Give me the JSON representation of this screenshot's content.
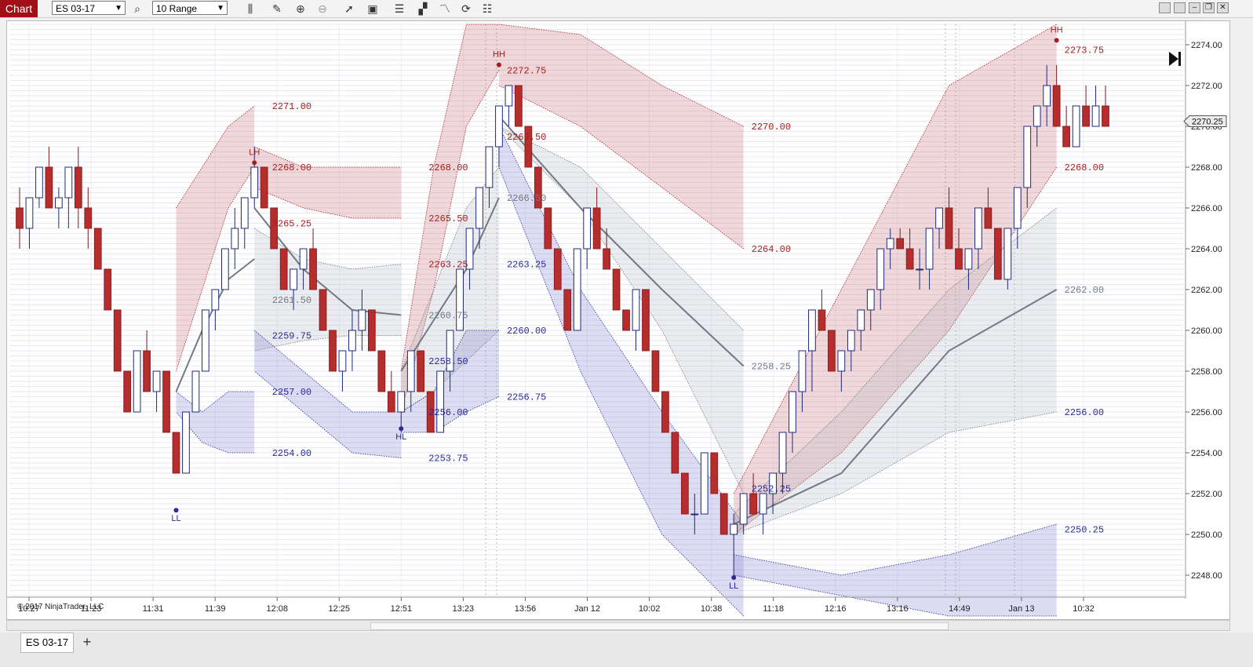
{
  "toolbar": {
    "chart_label": "Chart",
    "instrument": "ES 03-17",
    "bar_type": "10 Range"
  },
  "tabs": [
    {
      "label": "ES 03-17"
    },
    {
      "label": "+"
    }
  ],
  "copyright": "© 2017 NinjaTrader, LLC",
  "colors": {
    "up_bar": "#ffffff",
    "up_outline": "#1c2a7a",
    "down_bar": "#b52d2d",
    "resistance": "#a81e1e",
    "support": "#2a2a9a",
    "mid": "#707a82",
    "accent": "#a10f17"
  },
  "chart_data": {
    "type": "candlestick",
    "y_range": [
      2247,
      2275
    ],
    "y_ticks": [
      "2274.00",
      "2272.00",
      "2270.00",
      "2268.00",
      "2266.00",
      "2264.00",
      "2262.00",
      "2260.00",
      "2258.00",
      "2256.00",
      "2254.00",
      "2252.00",
      "2250.00",
      "2248.00"
    ],
    "last_price": "2270.25",
    "x_labels": [
      "10:27",
      "11:23",
      "11:31",
      "11:39",
      "12:08",
      "12:25",
      "12:51",
      "13:23",
      "13:56",
      "Jan 12",
      "10:02",
      "10:38",
      "11:18",
      "12:16",
      "13:16",
      "14:49",
      "Jan 13",
      "10:32"
    ],
    "bars": [
      [
        2266,
        2267,
        2264,
        2265
      ],
      [
        2265,
        2266,
        2264,
        2266.5
      ],
      [
        2266.5,
        2268,
        2266,
        2268
      ],
      [
        2268,
        2269,
        2266,
        2266
      ],
      [
        2266,
        2267,
        2265,
        2266.5
      ],
      [
        2266.5,
        2268,
        2265,
        2268
      ],
      [
        2268,
        2269,
        2265,
        2266
      ],
      [
        2266,
        2267,
        2264,
        2265
      ],
      [
        2265,
        2265,
        2263,
        2263
      ],
      [
        2263,
        2263,
        2262,
        2261
      ],
      [
        2261,
        2261,
        2258,
        2258
      ],
      [
        2258,
        2258,
        2256,
        2256
      ],
      [
        2256,
        2257,
        2256,
        2259
      ],
      [
        2259,
        2260,
        2259,
        2257
      ],
      [
        2257,
        2258,
        2256,
        2258
      ],
      [
        2258,
        2258,
        2256,
        2255
      ],
      [
        2255,
        2255,
        2254,
        2253
      ],
      [
        2253,
        2256,
        2253,
        2256
      ],
      [
        2256,
        2258,
        2256,
        2258
      ],
      [
        2258,
        2259,
        2258,
        2261
      ],
      [
        2261,
        2262,
        2260,
        2262
      ],
      [
        2262,
        2263,
        2262,
        2264
      ],
      [
        2264,
        2266,
        2263,
        2265
      ],
      [
        2265,
        2266,
        2264,
        2266.5
      ],
      [
        2266.5,
        2269,
        2266,
        2268
      ],
      [
        2268,
        2268,
        2266,
        2266
      ],
      [
        2266,
        2266,
        2264,
        2264
      ],
      [
        2264,
        2264,
        2262,
        2262
      ],
      [
        2262,
        2263,
        2261,
        2263
      ],
      [
        2263,
        2264,
        2262,
        2264
      ],
      [
        2264,
        2265,
        2262,
        2262
      ],
      [
        2262,
        2262,
        2260,
        2260
      ],
      [
        2260,
        2260,
        2258,
        2258
      ],
      [
        2258,
        2259,
        2257,
        2259
      ],
      [
        2259,
        2261,
        2258,
        2260
      ],
      [
        2260,
        2262,
        2259,
        2261
      ],
      [
        2261,
        2261,
        2259,
        2259
      ],
      [
        2259,
        2259,
        2257,
        2257
      ],
      [
        2257,
        2258,
        2256,
        2256
      ],
      [
        2256,
        2256,
        2255,
        2257
      ],
      [
        2257,
        2258,
        2256,
        2259
      ],
      [
        2259,
        2259,
        2257,
        2257
      ],
      [
        2257,
        2257,
        2255,
        2255
      ],
      [
        2255,
        2258,
        2255,
        2258
      ],
      [
        2258,
        2259,
        2257,
        2260
      ],
      [
        2260,
        2263,
        2260,
        2263
      ],
      [
        2263,
        2264,
        2262,
        2265
      ],
      [
        2265,
        2267,
        2264,
        2267
      ],
      [
        2267,
        2268,
        2266,
        2269
      ],
      [
        2269,
        2271,
        2268,
        2271
      ],
      [
        2271,
        2272,
        2270,
        2272
      ],
      [
        2272,
        2272,
        2270,
        2270
      ],
      [
        2270,
        2270,
        2268,
        2268
      ],
      [
        2268,
        2268,
        2266,
        2266
      ],
      [
        2266,
        2266,
        2264,
        2264
      ],
      [
        2264,
        2264,
        2262,
        2262
      ],
      [
        2262,
        2262,
        2260,
        2260
      ],
      [
        2260,
        2264,
        2260,
        2264
      ],
      [
        2264,
        2266,
        2263,
        2266
      ],
      [
        2266,
        2267,
        2264,
        2264
      ],
      [
        2264,
        2265,
        2263,
        2263
      ],
      [
        2263,
        2263,
        2261,
        2261
      ],
      [
        2261,
        2261,
        2260,
        2260
      ],
      [
        2260,
        2262,
        2259,
        2262
      ],
      [
        2262,
        2262,
        2259,
        2259
      ],
      [
        2259,
        2259,
        2257,
        2257
      ],
      [
        2257,
        2257,
        2255,
        2255
      ],
      [
        2255,
        2255,
        2253,
        2253
      ],
      [
        2253,
        2253,
        2251,
        2251
      ],
      [
        2251,
        2252,
        2250,
        2251
      ],
      [
        2251,
        2254,
        2251,
        2254
      ],
      [
        2254,
        2254,
        2252,
        2252
      ],
      [
        2252,
        2252,
        2250,
        2250
      ],
      [
        2250,
        2251,
        2248,
        2250.5
      ],
      [
        2250.5,
        2252,
        2250,
        2252
      ],
      [
        2252,
        2253,
        2251,
        2251
      ],
      [
        2251,
        2252,
        2250,
        2252
      ],
      [
        2252,
        2253,
        2251,
        2253
      ],
      [
        2253,
        2255,
        2252,
        2255
      ],
      [
        2255,
        2257,
        2254,
        2257
      ],
      [
        2257,
        2259,
        2256,
        2259
      ],
      [
        2259,
        2260,
        2257,
        2261
      ],
      [
        2261,
        2262,
        2260,
        2260
      ],
      [
        2260,
        2260,
        2258,
        2258
      ],
      [
        2258,
        2259,
        2257,
        2259
      ],
      [
        2259,
        2260,
        2258,
        2260
      ],
      [
        2260,
        2261,
        2259,
        2261
      ],
      [
        2261,
        2262,
        2260,
        2262
      ],
      [
        2262,
        2263,
        2261,
        2264
      ],
      [
        2264,
        2265,
        2263,
        2264.5
      ],
      [
        2264.5,
        2265,
        2264,
        2264
      ],
      [
        2264,
        2265,
        2263,
        2263
      ],
      [
        2263,
        2264,
        2262,
        2263
      ],
      [
        2263,
        2265,
        2262,
        2265
      ],
      [
        2265,
        2266,
        2264,
        2266
      ],
      [
        2266,
        2267,
        2265,
        2264
      ],
      [
        2264,
        2265,
        2263,
        2263
      ],
      [
        2263,
        2264,
        2262,
        2264
      ],
      [
        2264,
        2266,
        2263,
        2266
      ],
      [
        2266,
        2267,
        2265,
        2265
      ],
      [
        2265,
        2265,
        2263,
        2262.5
      ],
      [
        2262.5,
        2265,
        2262,
        2265
      ],
      [
        2265,
        2267,
        2264,
        2267
      ],
      [
        2267,
        2270,
        2266,
        2270
      ],
      [
        2270,
        2271,
        2269,
        2271
      ],
      [
        2271,
        2273,
        2270,
        2272
      ],
      [
        2272,
        2273,
        2270,
        2270
      ],
      [
        2270,
        2271,
        2269,
        2269
      ],
      [
        2269,
        2271,
        2269,
        2271
      ],
      [
        2271,
        2272,
        2270,
        2270
      ],
      [
        2270,
        2272,
        2270,
        2271
      ],
      [
        2271,
        2272,
        2270,
        2270
      ]
    ],
    "pivot_labels": [
      {
        "text": "LL",
        "value": 2250.8,
        "bar": 16
      },
      {
        "text": "LH",
        "value": 2268.6,
        "bar": 24
      },
      {
        "text": "HL",
        "value": 2254.8,
        "bar": 39
      },
      {
        "text": "HH",
        "value": 2273.4,
        "bar": 49
      },
      {
        "text": "LL",
        "value": 2247.5,
        "bar": 73
      },
      {
        "text": "HH",
        "value": 2274.6,
        "bar": 106
      }
    ],
    "level_labels": [
      {
        "text": "2271.00",
        "value": 2271,
        "kind": "resistance",
        "bar": 25
      },
      {
        "text": "2268.00",
        "value": 2268,
        "kind": "resistance",
        "bar": 25
      },
      {
        "text": "2265.25",
        "value": 2265.25,
        "kind": "resistance",
        "bar": 25
      },
      {
        "text": "2261.50",
        "value": 2261.5,
        "kind": "mid",
        "bar": 25
      },
      {
        "text": "2259.75",
        "value": 2259.75,
        "kind": "support",
        "bar": 25
      },
      {
        "text": "2257.00",
        "value": 2257,
        "kind": "support",
        "bar": 25
      },
      {
        "text": "2254.00",
        "value": 2254,
        "kind": "support",
        "bar": 25
      },
      {
        "text": "2272.75",
        "value": 2272.75,
        "kind": "resistance",
        "bar": 49
      },
      {
        "text": "2268.00",
        "value": 2268,
        "kind": "resistance",
        "bar": 41
      },
      {
        "text": "2265.50",
        "value": 2265.5,
        "kind": "resistance",
        "bar": 41
      },
      {
        "text": "2263.25",
        "value": 2263.25,
        "kind": "resistance",
        "bar": 41
      },
      {
        "text": "2260.75",
        "value": 2260.75,
        "kind": "mid",
        "bar": 41
      },
      {
        "text": "2258.50",
        "value": 2258.5,
        "kind": "support",
        "bar": 41
      },
      {
        "text": "2256.00",
        "value": 2256,
        "kind": "support",
        "bar": 41
      },
      {
        "text": "2253.75",
        "value": 2253.75,
        "kind": "support",
        "bar": 41
      },
      {
        "text": "2269.50",
        "value": 2269.5,
        "kind": "resistance",
        "bar": 49
      },
      {
        "text": "2266.50",
        "value": 2266.5,
        "kind": "mid",
        "bar": 49
      },
      {
        "text": "2263.25",
        "value": 2263.25,
        "kind": "support",
        "bar": 49
      },
      {
        "text": "2260.00",
        "value": 2260,
        "kind": "support",
        "bar": 49
      },
      {
        "text": "2256.75",
        "value": 2256.75,
        "kind": "support",
        "bar": 49
      },
      {
        "text": "2270.00",
        "value": 2270,
        "kind": "resistance",
        "bar": 74
      },
      {
        "text": "2264.00",
        "value": 2264,
        "kind": "resistance",
        "bar": 74
      },
      {
        "text": "2258.25",
        "value": 2258.25,
        "kind": "mid",
        "bar": 74
      },
      {
        "text": "2252.25",
        "value": 2252.25,
        "kind": "support",
        "bar": 74
      },
      {
        "text": "2273.75",
        "value": 2273.75,
        "kind": "resistance",
        "bar": 106
      },
      {
        "text": "2268.00",
        "value": 2268,
        "kind": "resistance",
        "bar": 106
      },
      {
        "text": "2262.00",
        "value": 2262,
        "kind": "mid",
        "bar": 106
      },
      {
        "text": "2256.00",
        "value": 2256,
        "kind": "support",
        "bar": 106
      },
      {
        "text": "2250.25",
        "value": 2250.25,
        "kind": "support",
        "bar": 106
      }
    ],
    "bands": [
      {
        "kind": "resistance",
        "upper": [
          2266,
          2268,
          2270,
          2271
        ],
        "lower": [
          2258,
          2262,
          2266,
          2268
        ],
        "start_bar": 16,
        "end_bar": 24
      },
      {
        "kind": "resistance",
        "upper": [
          2269,
          2268,
          2268,
          2268
        ],
        "lower": [
          2267,
          2266,
          2265.5,
          2265.5
        ],
        "start_bar": 24,
        "end_bar": 39
      },
      {
        "kind": "mid",
        "upper": [
          2265,
          2263.5,
          2263,
          2263.25
        ],
        "lower": [
          2259,
          2259.5,
          2259.75,
          2259.75
        ],
        "start_bar": 24,
        "end_bar": 39
      },
      {
        "kind": "support",
        "upper": [
          2257,
          2256,
          2257,
          2257
        ],
        "lower": [
          2256,
          2254.5,
          2254,
          2254
        ],
        "start_bar": 16,
        "end_bar": 24
      },
      {
        "kind": "support",
        "upper": [
          2260,
          2258,
          2256,
          2256
        ],
        "lower": [
          2258,
          2256,
          2254,
          2253.75
        ],
        "start_bar": 24,
        "end_bar": 39
      },
      {
        "kind": "resistance",
        "upper": [
          2258,
          2268,
          2275,
          2275
        ],
        "lower": [
          2256,
          2262,
          2270,
          2272.75
        ],
        "start_bar": 39,
        "end_bar": 49
      },
      {
        "kind": "mid",
        "upper": [
          2258,
          2262,
          2266,
          2268
        ],
        "lower": [
          2256,
          2257,
          2258.5,
          2260
        ],
        "start_bar": 39,
        "end_bar": 49
      },
      {
        "kind": "support",
        "upper": [
          2256,
          2257,
          2260,
          2260
        ],
        "lower": [
          2255,
          2255,
          2256,
          2256.75
        ],
        "start_bar": 39,
        "end_bar": 49
      },
      {
        "kind": "resistance",
        "upper": [
          2275,
          2274.5,
          2272,
          2270
        ],
        "lower": [
          2272,
          2270,
          2267,
          2264
        ],
        "start_bar": 49,
        "end_bar": 74
      },
      {
        "kind": "mid",
        "upper": [
          2270,
          2268,
          2264,
          2260
        ],
        "lower": [
          2270,
          2266,
          2260,
          2252
        ],
        "start_bar": 49,
        "end_bar": 74
      },
      {
        "kind": "support",
        "upper": [
          2270,
          2262,
          2256,
          2250.5
        ],
        "lower": [
          2268,
          2258,
          2250,
          2246
        ],
        "start_bar": 49,
        "end_bar": 74
      },
      {
        "kind": "resistance",
        "upper": [
          2252,
          2262,
          2272,
          2275
        ],
        "lower": [
          2250,
          2254,
          2260,
          2268
        ],
        "start_bar": 73,
        "end_bar": 106
      },
      {
        "kind": "mid",
        "upper": [
          2251,
          2256,
          2262,
          2266
        ],
        "lower": [
          2250,
          2252,
          2255,
          2256
        ],
        "start_bar": 73,
        "end_bar": 106
      },
      {
        "kind": "support",
        "upper": [
          2249,
          2248,
          2249,
          2250.5
        ],
        "lower": [
          2248,
          2247,
          2246,
          2246
        ],
        "start_bar": 73,
        "end_bar": 106
      }
    ],
    "mid_lines": [
      {
        "values": [
          2257,
          2260,
          2262.5,
          2263.5
        ],
        "start_bar": 16,
        "end_bar": 24
      },
      {
        "values": [
          2266,
          2263,
          2261,
          2260.75
        ],
        "start_bar": 24,
        "end_bar": 39
      },
      {
        "values": [
          2258,
          2260.5,
          2263,
          2266.5
        ],
        "start_bar": 39,
        "end_bar": 49
      },
      {
        "values": [
          2270.5,
          2266,
          2262,
          2258.25
        ],
        "start_bar": 49,
        "end_bar": 74
      },
      {
        "values": [
          2250.5,
          2253,
          2259,
          2262
        ],
        "start_bar": 73,
        "end_bar": 106
      }
    ]
  }
}
